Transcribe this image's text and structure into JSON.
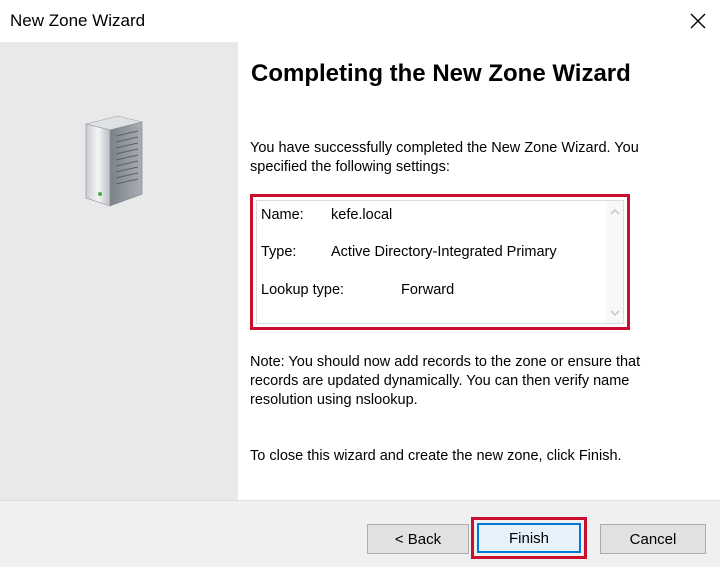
{
  "window": {
    "title": "New Zone Wizard",
    "close_icon": "close-icon"
  },
  "left_panel": {
    "icon": "server-icon",
    "background_color": "#e9e9e9"
  },
  "main": {
    "heading": "Completing the New Zone Wizard",
    "intro": "You have successfully completed the New Zone Wizard. You specified the following settings:",
    "settings": [
      {
        "label": "Name:",
        "value": "kefe.local"
      },
      {
        "label": "Type:",
        "value": "Active Directory-Integrated Primary"
      },
      {
        "label": "Lookup type:",
        "value": "Forward"
      }
    ],
    "note": "Note: You should now add records to the zone or ensure that records are updated dynamically. You can then verify name resolution using nslookup.",
    "closing": "To close this wizard and create the new zone, click Finish."
  },
  "buttons": {
    "back": "< Back",
    "finish": "Finish",
    "cancel": "Cancel"
  },
  "colors": {
    "highlight": "#c8102e",
    "focus_border": "#0078d7"
  }
}
